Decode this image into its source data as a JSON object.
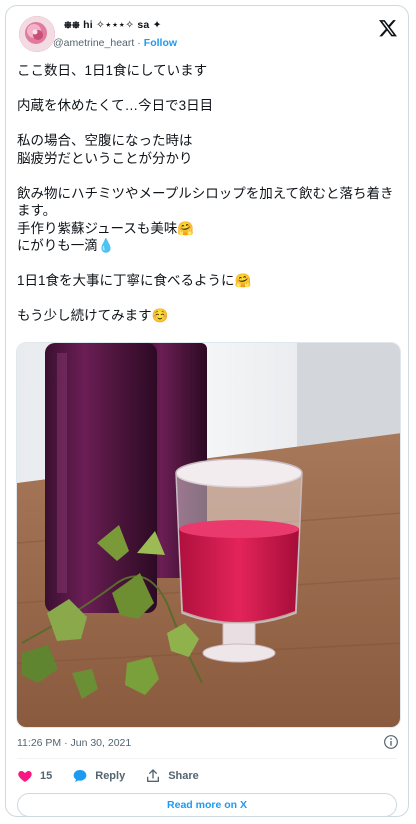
{
  "author": {
    "display_name": "᪥᪥ hi ✧⋆⋆⋆✧ sa ✦",
    "handle": "@ametrine_heart",
    "follow_label": "Follow",
    "separator": "·"
  },
  "tweet": {
    "lines": [
      "ここ数日、1日1食にしています",
      "",
      "内蔵を休めたくて…今日で3日目",
      "",
      "私の場合、空腹になった時は",
      "脳疲労だということが分かり",
      "",
      "飲み物にハチミツやメープルシロップを加えて飲むと落ち着きます。",
      "手作り紫蘇ジュースも美味🤗",
      "にがりも一滴💧",
      "",
      "1日1食を大事に丁寧に食べるように🤗",
      "",
      "もう少し続けてみます☺️"
    ],
    "timestamp": "11:26 PM · Jun 30, 2021"
  },
  "actions": {
    "like_count": "15",
    "reply_label": "Reply",
    "share_label": "Share"
  },
  "read_more_label": "Read more on X",
  "icons": {
    "like": "heart-icon",
    "reply": "speech-bubble-icon",
    "share": "share-arrow-icon",
    "info": "info-icon",
    "brand": "x-logo-icon"
  },
  "colors": {
    "like": "#f91880",
    "reply": "#1d9bf0",
    "link": "#1d9bf0",
    "text_secondary": "#536471"
  }
}
